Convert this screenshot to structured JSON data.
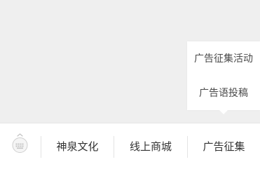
{
  "popup_menu": {
    "items": [
      {
        "label": "广告征集活动"
      },
      {
        "label": "广告语投稿"
      }
    ]
  },
  "bottom_nav": {
    "keyboard_toggle_icon": "keyboard-icon",
    "tabs": [
      {
        "label": "神泉文化"
      },
      {
        "label": "线上商城"
      },
      {
        "label": "广告征集"
      }
    ]
  },
  "colors": {
    "background": "#efefef",
    "bar_background": "#ffffff",
    "divider": "#e3e3e3",
    "text": "#333333"
  }
}
